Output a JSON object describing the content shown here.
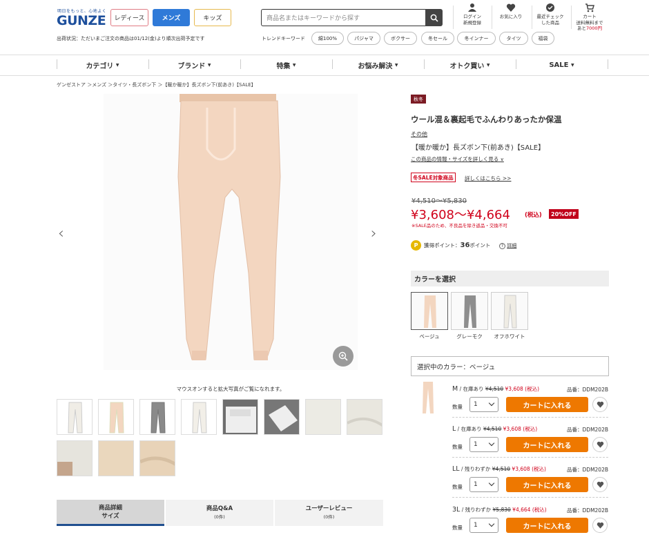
{
  "header": {
    "logo_tagline": "明日をもっと、心地よく",
    "logo": "GUNZE",
    "gender_buttons": [
      "レディース",
      "メンズ",
      "キッズ"
    ],
    "shipping_notice": "出荷状況：ただいまご注文の商品は01/12(金)より順次出荷予定です",
    "search_placeholder": "商品名またはキーワードから探す",
    "trend_label": "トレンドキーワード",
    "trend_keywords": [
      "綿100%",
      "パジャマ",
      "ボクサー",
      "冬セール",
      "冬インナー",
      "タイツ",
      "福袋"
    ],
    "icons": {
      "login_l1": "ログイン",
      "login_l2": "新規登録",
      "fav": "お気に入り",
      "recent_l1": "最近チェック",
      "recent_l2": "した商品",
      "cart": "カート",
      "cart_note1": "送料無料まで",
      "cart_note2a": "あと",
      "cart_note2b": "7000円"
    }
  },
  "nav": [
    "カテゴリ",
    "ブランド",
    "特集",
    "お悩み解決",
    "オトク買い",
    "SALE"
  ],
  "breadcrumb": "ゲンゼストア ＞メンズ ＞タイツ・長ズボン下 ＞【暖か暖か】長ズボン下(前あき)【SALE】",
  "gallery": {
    "zoom_hint": "マウスオンすると拡大写真がご覧になれます。"
  },
  "tabs": [
    {
      "label": "商品詳細",
      "sub": "サイズ"
    },
    {
      "label": "商品Q&A",
      "sub": "(0件)"
    },
    {
      "label": "ユーザーレビュー",
      "sub": "(0件)"
    }
  ],
  "product": {
    "season": "秋冬",
    "catch": "ウール混＆裏起毛でふんわりあったか保温",
    "brand": "その他",
    "name": "【暖か暖か】長ズボン下(前あき)【SALE】",
    "more_info": "この商品の情報・サイズを詳しく見る",
    "sale_tag": "冬SALE対象商品",
    "sale_link": "詳しくはこちら >>",
    "old_price": "¥4,510〜¥5,830",
    "price": "¥3,608〜¥4,664",
    "tax": "(税込)",
    "discount": "20%OFF",
    "note": "※SALE品のため、不良品を除き返品・交換不可",
    "points_label": "獲得ポイント：",
    "points_value": "36",
    "points_unit": "ポイント",
    "points_help": "詳細",
    "color_header": "カラーを選択",
    "colors": [
      "ベージュ",
      "グレーモク",
      "オフホワイト"
    ],
    "selected_color": "選択中のカラー：ベージュ",
    "skus": [
      {
        "size": "M",
        "stock": "在庫あり",
        "old": "¥4,510",
        "price": "¥3,608",
        "tax": "(税込)",
        "code": "品番：DDM202B",
        "qty": "1",
        "cart": "カートに入れる"
      },
      {
        "size": "L",
        "stock": "在庫あり",
        "old": "¥4,510",
        "price": "¥3,608",
        "tax": "(税込)",
        "code": "品番：DDM202B",
        "qty": "1",
        "cart": "カートに入れる"
      },
      {
        "size": "LL",
        "stock": "残りわずか",
        "old": "¥4,510",
        "price": "¥3,608",
        "tax": "(税込)",
        "code": "品番：DDM202B",
        "qty": "1",
        "cart": "カートに入れる"
      },
      {
        "size": "3L",
        "stock": "残りわずか",
        "old": "¥5,830",
        "price": "¥4,664",
        "tax": "(税込)",
        "code": "品番：DDM202B",
        "qty": "1",
        "cart": "カートに入れる"
      }
    ],
    "qty_label": "数量"
  },
  "colors": {
    "brand_blue": "#1d4f9c",
    "sale_red": "#d0021b",
    "cart_orange": "#ee7800",
    "mens_blue": "#2f7ad8"
  }
}
